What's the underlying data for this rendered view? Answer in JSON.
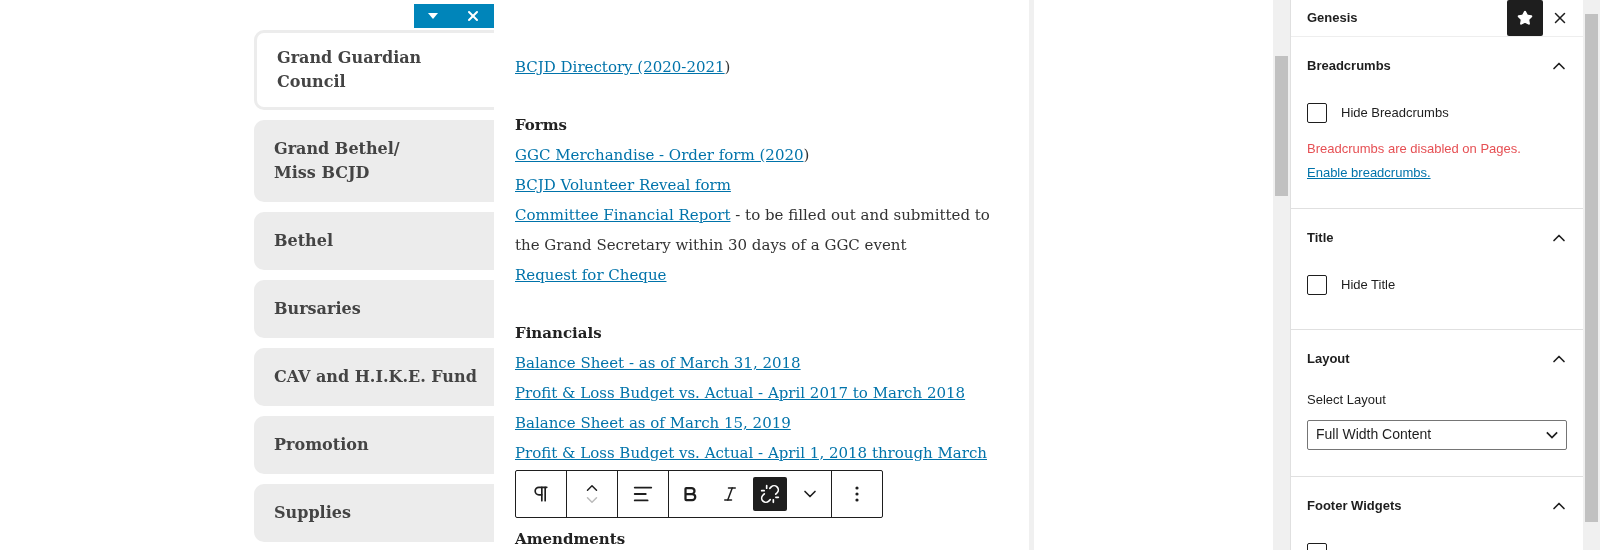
{
  "editor_tabs": [
    {
      "label": "Grand Guardian Council",
      "selected": true
    },
    {
      "label": "Grand Bethel/\nMiss BCJD",
      "selected": false
    },
    {
      "label": "Bethel",
      "selected": false
    },
    {
      "label": "Bursaries",
      "selected": false
    },
    {
      "label": "CAV and H.I.K.E. Fund",
      "selected": false
    },
    {
      "label": "Promotion",
      "selected": false
    },
    {
      "label": "Supplies",
      "selected": false
    }
  ],
  "content": [
    {
      "kind": "line",
      "parts": [
        {
          "text": "BCJD Directory (2020-2021",
          "link": true
        },
        {
          "text": ")",
          "link": false
        }
      ]
    },
    {
      "kind": "heading",
      "text": "Forms"
    },
    {
      "kind": "line",
      "parts": [
        {
          "text": "GGC Merchandise - Order form (2020",
          "link": true
        },
        {
          "text": ")",
          "link": false
        }
      ]
    },
    {
      "kind": "line",
      "parts": [
        {
          "text": "BCJD Volunteer Reveal form",
          "link": true
        }
      ]
    },
    {
      "kind": "line",
      "parts": [
        {
          "text": "Committee Financial Report",
          "link": true
        },
        {
          "text": " - to be filled out and submitted to the Grand Secretary within 30 days of a GGC event",
          "link": false
        }
      ]
    },
    {
      "kind": "line",
      "parts": [
        {
          "text": "Request for Cheque",
          "link": true
        }
      ]
    },
    {
      "kind": "heading",
      "text": "Financials"
    },
    {
      "kind": "line",
      "parts": [
        {
          "text": "Balance Sheet - as of March 31, 2018",
          "link": true
        }
      ]
    },
    {
      "kind": "line",
      "parts": [
        {
          "text": "Profit & Loss Budget vs. Actual - April 2017 to March 2018",
          "link": true
        }
      ]
    },
    {
      "kind": "line",
      "parts": [
        {
          "text": "Balance Sheet as of March 15, 2019",
          "link": true
        }
      ]
    },
    {
      "kind": "line",
      "parts": [
        {
          "text": "Profit & Loss Budget vs. Actual - April 1, 2018 through March",
          "link": true
        }
      ]
    },
    {
      "kind": "toolbar"
    },
    {
      "kind": "heading",
      "text": "Amendments"
    }
  ],
  "toolbar_groups": [
    [
      {
        "kind": "paragraph",
        "selected": false
      }
    ],
    [
      {
        "kind": "move",
        "selected": false
      }
    ],
    [
      {
        "kind": "align",
        "selected": false
      }
    ],
    [
      {
        "kind": "bold",
        "selected": false
      },
      {
        "kind": "italic",
        "selected": false
      },
      {
        "kind": "unlink",
        "selected": true
      },
      {
        "kind": "more-formats",
        "selected": false
      }
    ],
    [
      {
        "kind": "options",
        "selected": false
      }
    ]
  ],
  "sidebar": {
    "title": "Genesis",
    "pinned": true,
    "sections": [
      {
        "title": "Breadcrumbs",
        "expanded": true,
        "controls": [
          {
            "kind": "checkbox",
            "label": "Hide Breadcrumbs",
            "checked": false
          },
          {
            "kind": "notice",
            "text": "Breadcrumbs are disabled on Pages."
          },
          {
            "kind": "link",
            "text": "Enable breadcrumbs."
          }
        ]
      },
      {
        "title": "Title",
        "expanded": true,
        "controls": [
          {
            "kind": "checkbox",
            "label": "Hide Title",
            "checked": false
          }
        ]
      },
      {
        "title": "Layout",
        "expanded": true,
        "controls": [
          {
            "kind": "select",
            "label": "Select Layout",
            "value": "Full Width Content"
          }
        ]
      },
      {
        "title": "Footer Widgets",
        "expanded": true,
        "controls": [
          {
            "kind": "checkbox",
            "checked": false
          }
        ]
      }
    ]
  }
}
